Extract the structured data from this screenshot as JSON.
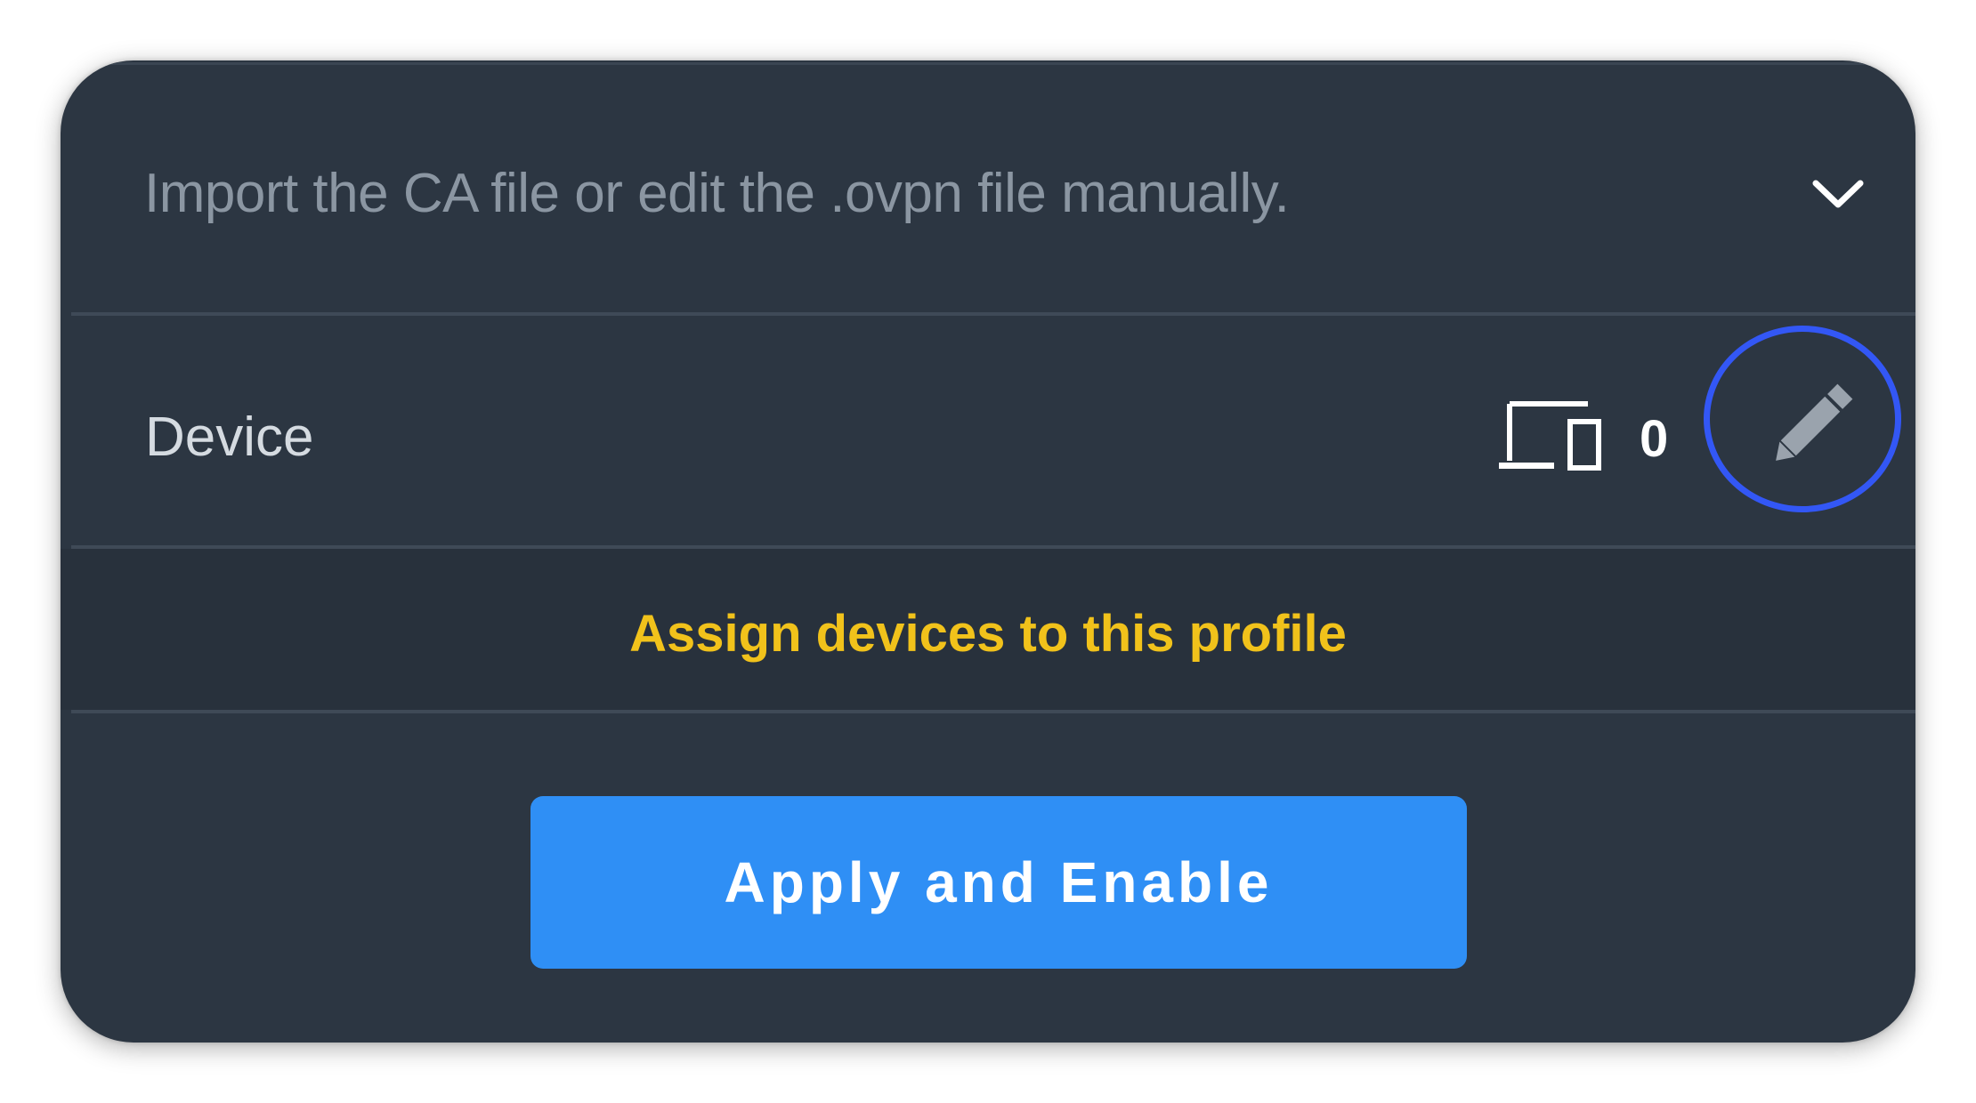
{
  "ca_section": {
    "description": "Import the CA file or edit the .ovpn file manually.",
    "expand_icon": "chevron-down-icon"
  },
  "device_row": {
    "label": "Device",
    "icon": "devices-icon",
    "count": "0",
    "edit_icon": "pencil-icon"
  },
  "assign": {
    "link_text": "Assign devices to this profile"
  },
  "actions": {
    "apply_label": "Apply and Enable"
  },
  "colors": {
    "card_background": "#2c3642",
    "assign_background": "#28313c",
    "link_yellow": "#f1c21b",
    "button_blue": "#2f8ff5",
    "highlight_ring": "#3357f5"
  }
}
